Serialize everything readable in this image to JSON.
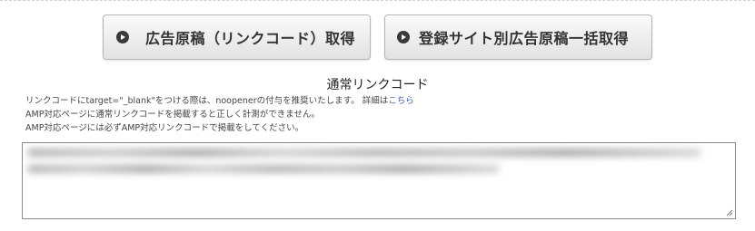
{
  "buttons": {
    "ad_code": "広告原稿（リンクコード）取得",
    "bulk_by_site": "登録サイト別広告原稿一括取得"
  },
  "section": {
    "title": "通常リンクコード"
  },
  "notes": {
    "line1_text": "リンクコードにtarget=\"_blank\"をつける際は、noopenerの付与を推奨いたします。 詳細は",
    "line1_link": "こちら",
    "line2": "AMP対応ページに通常リンクコードを掲載すると正しく計測ができません。",
    "line3": "AMP対応ページには必ずAMP対応リンクコードで掲載をしてください。"
  },
  "colors": {
    "link": "#3b5fc2",
    "button_icon": "#3a3a3a"
  },
  "icons": {
    "button_icon": "circle-arrow-right-icon"
  }
}
